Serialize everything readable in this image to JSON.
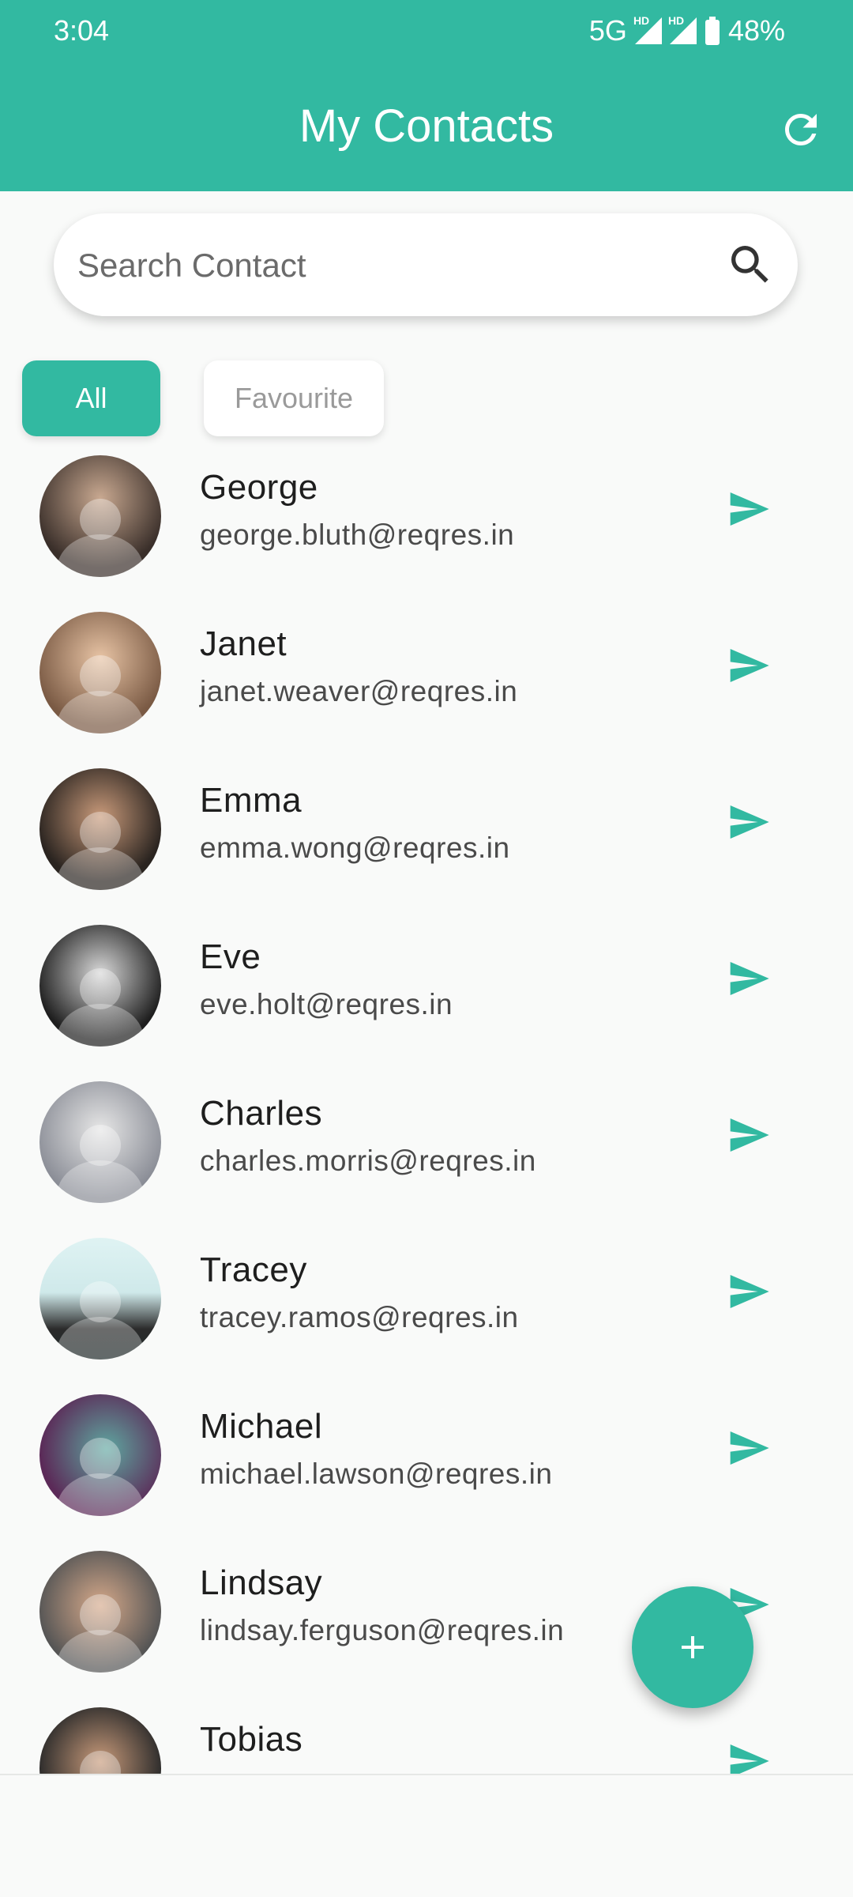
{
  "status_bar": {
    "time": "3:04",
    "network": "5G",
    "hd_label": "HD",
    "battery": "48%"
  },
  "header": {
    "title": "My Contacts"
  },
  "search": {
    "placeholder": "Search Contact",
    "value": ""
  },
  "filters": {
    "all_label": "All",
    "favourite_label": "Favourite",
    "selected": "All"
  },
  "contacts": [
    {
      "name": "George",
      "email": "george.bluth@reqres.in"
    },
    {
      "name": "Janet",
      "email": "janet.weaver@reqres.in"
    },
    {
      "name": "Emma",
      "email": "emma.wong@reqres.in"
    },
    {
      "name": "Eve",
      "email": "eve.holt@reqres.in"
    },
    {
      "name": "Charles",
      "email": "charles.morris@reqres.in"
    },
    {
      "name": "Tracey",
      "email": "tracey.ramos@reqres.in"
    },
    {
      "name": "Michael",
      "email": "michael.lawson@reqres.in"
    },
    {
      "name": "Lindsay",
      "email": "lindsay.ferguson@reqres.in"
    },
    {
      "name": "Tobias",
      "email": ""
    }
  ],
  "icons": {
    "refresh": "refresh-icon",
    "search": "search-icon",
    "send": "send-icon",
    "add": "plus-icon"
  },
  "colors": {
    "accent": "#32b9a1",
    "background": "#f9faf9"
  }
}
